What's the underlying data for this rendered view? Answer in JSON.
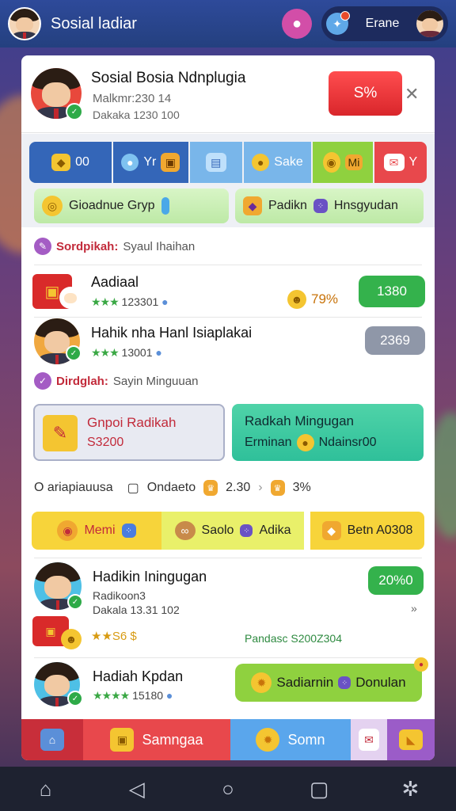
{
  "topbar": {
    "title": "Sosial ladiar",
    "username": "Erane"
  },
  "header": {
    "title": "Sosial Bosia Ndnplugia",
    "line1": "Malkmr:230 14",
    "line2": "Dakaka 1230 100",
    "action": "S%"
  },
  "tabs": [
    {
      "label": "00",
      "color": "#3466b8"
    },
    {
      "label": "Yr",
      "color": "#3466b8"
    },
    {
      "label": "",
      "color": "#79b6ea"
    },
    {
      "label": "Sake",
      "color": "#79b6ea"
    },
    {
      "label": "Mi",
      "color": "#8fd13f"
    },
    {
      "label": "Y",
      "color": "#e8484c"
    }
  ],
  "quick": [
    {
      "label": "Gioadnue Gryp"
    },
    {
      "label": "Padikn",
      "label2": "Hnsgyudan"
    }
  ],
  "section1": {
    "key": "Sordpikah:",
    "val": "Syaul Ihaihan"
  },
  "rows": [
    {
      "name": "Aadiaal",
      "stars": "★★★",
      "score": "123301",
      "pct": "79%",
      "badge": "1380",
      "badge_color": "#34b24c"
    },
    {
      "name": "Hahik nha Hanl Isiaplakai",
      "stars": "★★★",
      "score": "13001",
      "badge": "2369",
      "badge_color": "#8f97a8"
    }
  ],
  "section2": {
    "key": "Dirdglah:",
    "val": "Sayin Minguuan"
  },
  "cards": [
    {
      "title": "Gnpoi Radikah",
      "sub": "S3200"
    },
    {
      "title": "Radkah Mingugan",
      "sub": "Erminan",
      "sub2": "Ndainsr00"
    }
  ],
  "info": {
    "left": "O ariapiauusa",
    "mid": "Ondaeto",
    "v1": "2.30",
    "v2": "3%"
  },
  "yellow_buttons": [
    {
      "label": "Memi"
    },
    {
      "label": "Saolo",
      "label2": "Adika"
    },
    {
      "label": "Betn A0308"
    }
  ],
  "feature": {
    "name": "Hadikin Iningugan",
    "line1": "Radikoon3",
    "line2": "Dakala 13.31 102",
    "badge": "20%0",
    "stars": "★★",
    "stars_val": "S6 $",
    "foot": "Pandasc S200Z304",
    "arrow": "»"
  },
  "last": {
    "name": "Hadiah Kpdan",
    "stars": "★★★★",
    "score": "15180",
    "action": "Sadiarnin",
    "action2": "Donulan"
  },
  "bottom_tabs": [
    {
      "label": ""
    },
    {
      "label": "Samngaa"
    },
    {
      "label": "Somn"
    },
    {
      "label": ""
    }
  ],
  "colors": {
    "accent_red": "#e8484c",
    "accent_green": "#34b24c",
    "accent_yellow": "#f4c531"
  }
}
